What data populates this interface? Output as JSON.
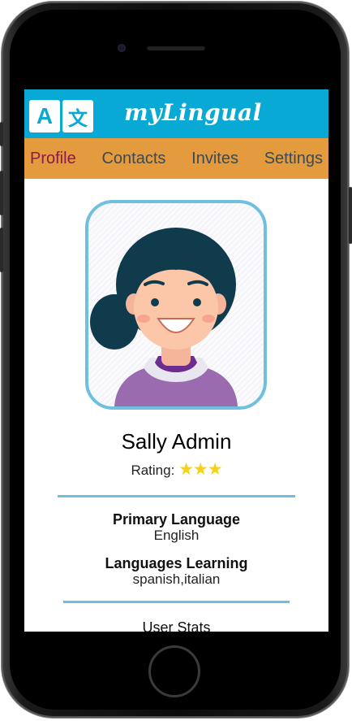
{
  "app": {
    "title": "myLingual",
    "logo_left": "A",
    "logo_right": "文"
  },
  "tabs": [
    {
      "label": "Profile",
      "active": true
    },
    {
      "label": "Contacts",
      "active": false
    },
    {
      "label": "Invites",
      "active": false
    },
    {
      "label": "Settings",
      "active": false
    }
  ],
  "profile": {
    "name": "Sally Admin",
    "rating_label": "Rating:",
    "rating": 3,
    "primary_language_title": "Primary Language",
    "primary_language": "English",
    "learning_title": "Languages Learning",
    "learning": "spanish,italian",
    "stats_title": "User Stats"
  },
  "colors": {
    "header": "#09a9d6",
    "tabs": "#e39b3e",
    "active_tab": "#8a1a4a",
    "divider": "#6fbfdc",
    "star": "#f5d218"
  }
}
